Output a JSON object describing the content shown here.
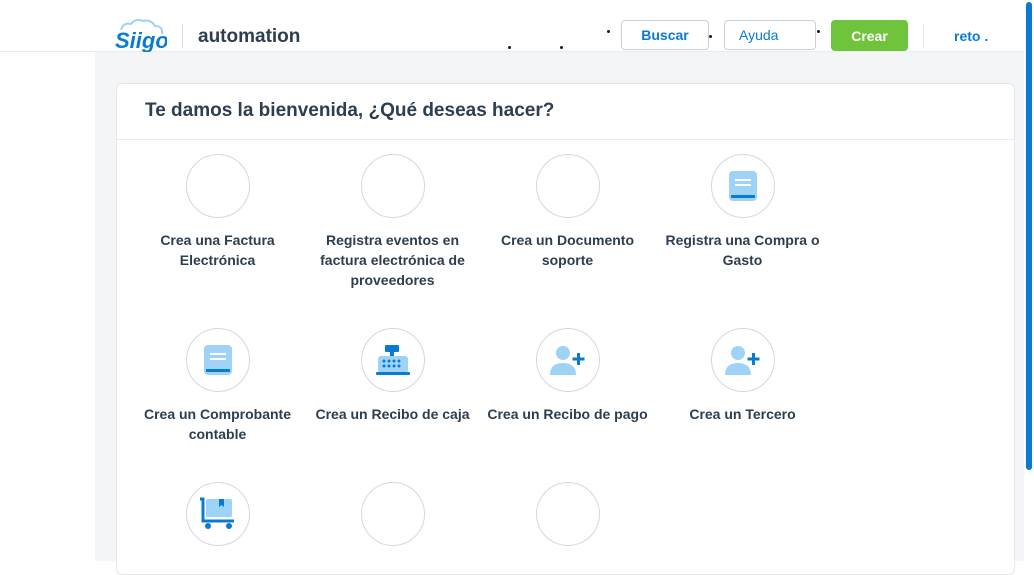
{
  "header": {
    "logo_text": "Siigo",
    "company": "automation",
    "search_label": "Buscar",
    "help_label": "Ayuda",
    "create_label": "Crear",
    "user": "reto ."
  },
  "welcome": {
    "title": "Te damos la bienvenida, ¿Qué deseas hacer?"
  },
  "actions": [
    {
      "label": "Crea una Factura Electrónica",
      "icon": "empty"
    },
    {
      "label": "Registra eventos en factura electrónica de proveedores",
      "icon": "empty"
    },
    {
      "label": "Crea un Documento soporte",
      "icon": "empty"
    },
    {
      "label": "Registra una Compra o Gasto",
      "icon": "document-icon"
    },
    {
      "label": "Crea un Comprobante contable",
      "icon": "document-icon"
    },
    {
      "label": "Crea un Recibo de caja",
      "icon": "cash-register-icon"
    },
    {
      "label": "Crea un Recibo de pago",
      "icon": "add-person-icon"
    },
    {
      "label": "Crea un Tercero",
      "icon": "add-person-icon"
    },
    {
      "label": "",
      "icon": "cart-box-icon"
    },
    {
      "label": "",
      "icon": "empty"
    },
    {
      "label": "",
      "icon": "empty"
    }
  ],
  "colors": {
    "primary": "#0a7bd3",
    "success": "#6fc43b",
    "icon_light": "#9fd3f5",
    "text": "#2c3e50"
  }
}
